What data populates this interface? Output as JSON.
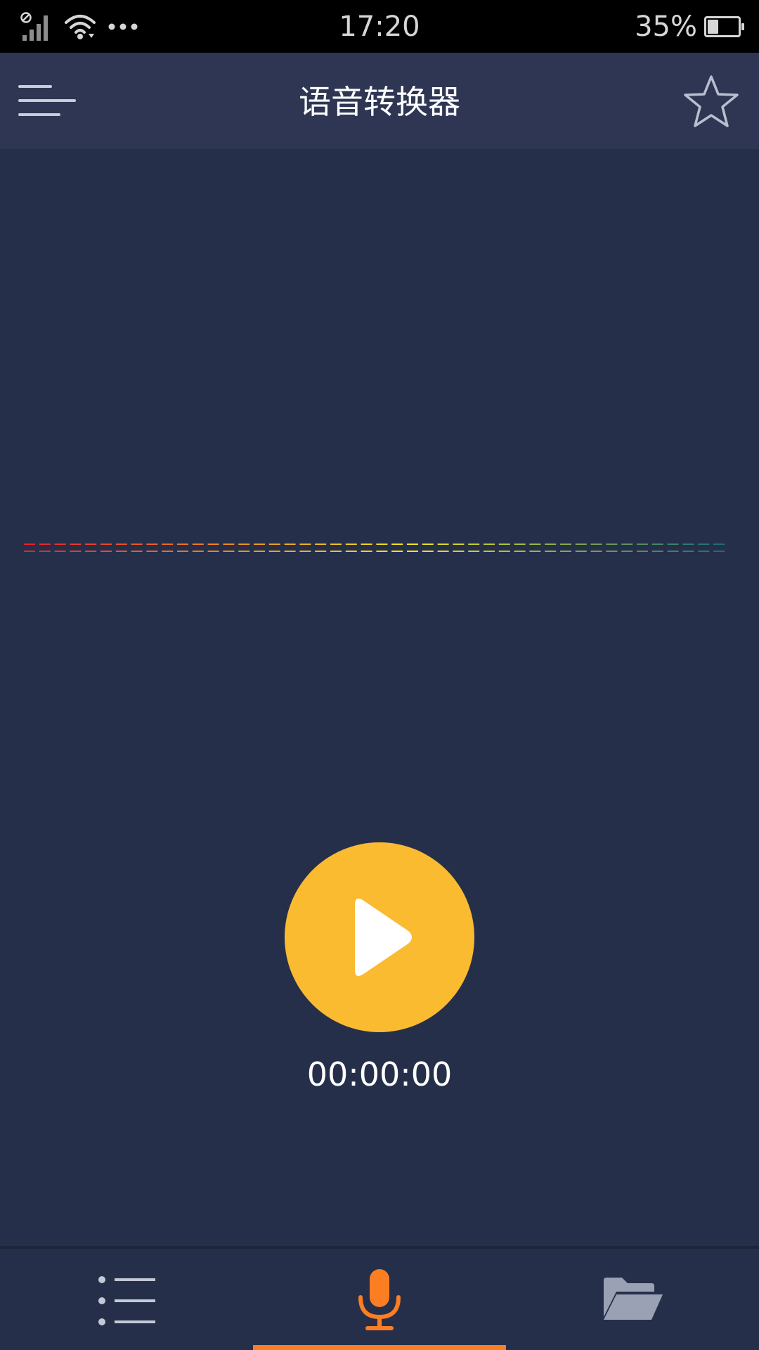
{
  "status_bar": {
    "time": "17:20",
    "battery_percent": "35%",
    "battery_level": 0.35,
    "icons": [
      "no-sim-signal-icon",
      "wifi-icon",
      "more-dots-icon",
      "battery-icon"
    ]
  },
  "app_bar": {
    "title": "语音转换器",
    "menu_icon": "menu-icon",
    "favorite_icon": "star-icon"
  },
  "level_meter": {
    "level": 0,
    "segment_count": 46,
    "color_from": "#e8202a",
    "color_mid": "#f2e81c",
    "color_to": "#1d6e78"
  },
  "player": {
    "play_icon": "play-icon",
    "elapsed_time": "00:00:00",
    "accent_color": "#fbbb31"
  },
  "bottom_nav": {
    "items": [
      {
        "icon": "list-icon",
        "active": false
      },
      {
        "icon": "microphone-icon",
        "active": true
      },
      {
        "icon": "folder-icon",
        "active": false
      }
    ],
    "active_color": "#fb7e23",
    "inactive_color": "#c5c9d6"
  }
}
